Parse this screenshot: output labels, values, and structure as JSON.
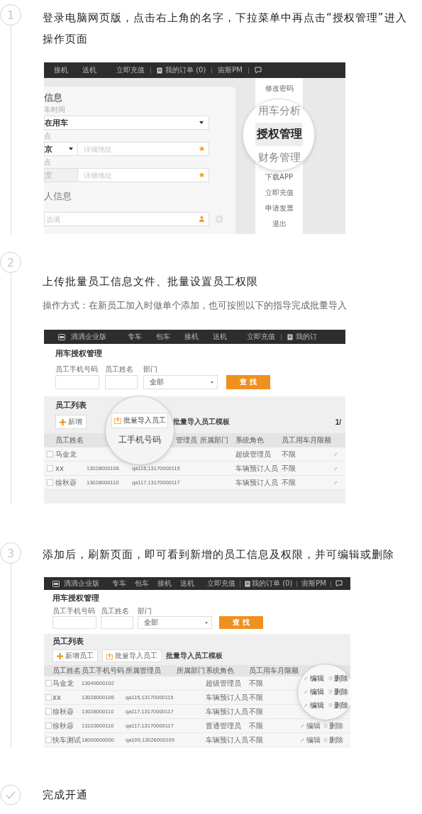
{
  "steps": [
    {
      "kind": "numbered",
      "number": "1",
      "text": "登录电脑网页版，点击右上角的名字，下拉菜单中再点击“授权管理”进入操作页面",
      "screenshot": {
        "kind": "menu",
        "nav": {
          "links": [
            "接机",
            "送机"
          ],
          "recharge": "立即充值",
          "orders": "我的订单 (0)",
          "user": "宙斯PM"
        },
        "form": {
          "section_1": "信息",
          "time_label": "车时间",
          "time_value": "在用车",
          "from_label": "点",
          "from_city": "京",
          "from_placeholder": "详细地址",
          "to_label": "点",
          "to_city": "京",
          "to_placeholder": "详细地址",
          "section_2": "人信息",
          "contact_placeholder": "选填"
        },
        "menu": {
          "items": [
            {
              "label": "修改密码",
              "magnified": false,
              "selected": false
            },
            {
              "label": "用车分析",
              "magnified": true,
              "selected": false
            },
            {
              "label": "授权管理",
              "magnified": true,
              "selected": true
            },
            {
              "label": "财务管理",
              "magnified": true,
              "selected": false
            },
            {
              "label": "下载APP",
              "magnified": false,
              "selected": false
            },
            {
              "label": "立即充值",
              "magnified": false,
              "selected": false
            },
            {
              "label": "申请发票",
              "magnified": false,
              "selected": false
            },
            {
              "label": "退出",
              "magnified": false,
              "selected": false
            }
          ]
        }
      }
    },
    {
      "kind": "numbered",
      "number": "2",
      "text": "上传批量员工信息文件、批量设置员工权限",
      "subtitle": "操作方式：在新员工加入时做单个添加，也可按照以下的指导完成批量导入",
      "screenshot": {
        "kind": "import",
        "nav": {
          "brand": "滴滴企业版",
          "links": [
            "专车",
            "包车",
            "接机",
            "送机"
          ],
          "recharge": "立即充值",
          "orders": "我的订"
        },
        "title": "用车授权管理",
        "filters": {
          "phone_label": "员工手机号码",
          "name_label": "员工姓名",
          "dept_label": "部门",
          "dept_value": "全部",
          "search": "查找"
        },
        "list_title": "员工列表",
        "add_button": "新增",
        "template_link": "批量导入员工模板",
        "pager": "1/",
        "columns": [
          "员工姓名",
          "管理员",
          "所属部门",
          "系统角色",
          "员工用车月限额"
        ],
        "rows": [
          {
            "checked": false,
            "name": "马金龙",
            "role": "超级管理员",
            "limit": "不限"
          },
          {
            "checked": false,
            "name": "xx",
            "phone": "13028000106",
            "admin": "qa115,13170000115",
            "role": "车辆预订人员",
            "limit": "不限"
          },
          {
            "checked": false,
            "name": "徐秋蓉",
            "phone": "13028000110",
            "admin": "qa117,13170000117",
            "role": "车辆预订人员",
            "limit": "不限"
          }
        ],
        "magnifier": {
          "button": "批量导入员工",
          "column": "工手机号码"
        }
      }
    },
    {
      "kind": "numbered",
      "number": "3",
      "text": "添加后，刷新页面，即可看到新增的员工信息及权限，并可编辑或删除",
      "screenshot": {
        "kind": "list",
        "nav": {
          "brand": "滴滴企业版",
          "links": [
            "专车",
            "包车",
            "接机",
            "送机"
          ],
          "recharge": "立即充值",
          "orders": "我的订单 (0)",
          "user": "宙斯PM"
        },
        "title": "用车授权管理",
        "filters": {
          "phone_label": "员工手机号码",
          "name_label": "员工姓名",
          "dept_label": "部门",
          "dept_value": "全部",
          "search": "查找"
        },
        "list_title": "员工列表",
        "add_button": "新增员工",
        "batch_button": "批量导入员工",
        "template_link": "批量导入员工模板",
        "columns": [
          "员工姓名",
          "员工手机号码",
          "所属管理员",
          "所属部门",
          "系统角色",
          "员工用车月限额"
        ],
        "rows": [
          {
            "checked": false,
            "name": "马金龙",
            "phone": "13049000102",
            "role": "超级管理员",
            "limit": "不限"
          },
          {
            "checked": false,
            "name": "xx",
            "phone": "13028000106",
            "admin": "qa115,13170000115",
            "role": "车辆预订人员",
            "limit": "不限"
          },
          {
            "checked": false,
            "name": "徐秋蓉",
            "phone": "13028000110",
            "admin": "qa117,13170000117",
            "role": "车辆预订人员",
            "limit": "不限"
          },
          {
            "checked": false,
            "name": "徐秋蓉",
            "phone": "13103000110",
            "admin": "qa117,13170000117",
            "role": "普通管理员",
            "limit": "不限",
            "edit": "编辑",
            "delete": "删除"
          },
          {
            "checked": false,
            "name": "快车测试",
            "phone": "18000000000",
            "admin": "qa109,13026000109",
            "role": "车辆预订人员",
            "limit": "不限",
            "edit": "编辑",
            "delete": "删除"
          }
        ],
        "magnifier": {
          "items": [
            {
              "edit": "编辑",
              "delete": "删除"
            },
            {
              "edit": "编辑",
              "delete": "删除"
            },
            {
              "edit": "编辑",
              "delete": "删除"
            }
          ]
        }
      }
    },
    {
      "kind": "done",
      "text": "完成开通"
    }
  ]
}
